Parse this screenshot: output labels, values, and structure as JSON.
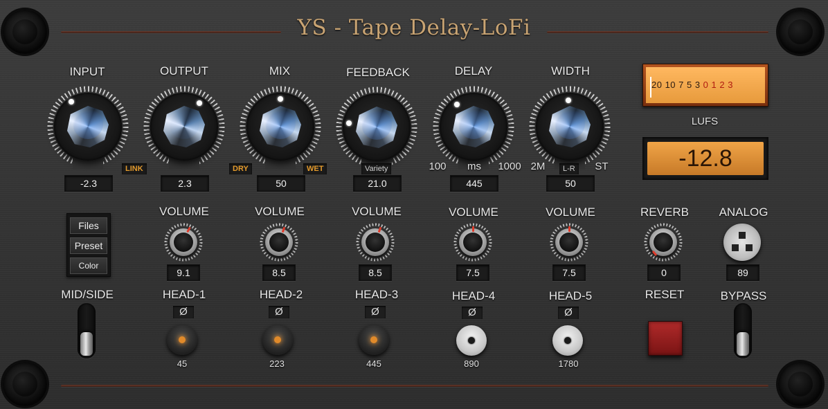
{
  "title": "YS - Tape Delay-LoFi",
  "main_knobs": [
    {
      "label": "INPUT",
      "value": "-2.3"
    },
    {
      "label": "OUTPUT",
      "value": "2.3"
    },
    {
      "label": "MIX",
      "value": "50"
    },
    {
      "label": "FEEDBACK",
      "value": "21.0"
    },
    {
      "label": "DELAY",
      "value": "445"
    },
    {
      "label": "WIDTH",
      "value": "50"
    }
  ],
  "knob_tags": {
    "link": "LINK",
    "dry": "DRY",
    "wet": "WET",
    "variety": "Variety",
    "delay_min": "100",
    "delay_unit": "ms",
    "delay_max": "1000",
    "width_min": "2M",
    "width_mid": "L-R",
    "width_max": "ST"
  },
  "meter": {
    "scale_black": "20  10  7  5  3  ",
    "scale_red": "0 1 2 3",
    "lufs_label": "LUFS",
    "lufs_value": "-12.8"
  },
  "menu": {
    "files": "Files",
    "preset": "Preset",
    "color": "Color"
  },
  "volumes": [
    {
      "label": "VOLUME",
      "value": "9.1"
    },
    {
      "label": "VOLUME",
      "value": "8.5"
    },
    {
      "label": "VOLUME",
      "value": "8.5"
    },
    {
      "label": "VOLUME",
      "value": "7.5"
    },
    {
      "label": "VOLUME",
      "value": "7.5"
    }
  ],
  "reverb": {
    "label": "REVERB",
    "value": "0"
  },
  "analog": {
    "label": "ANALOG",
    "value": "89"
  },
  "mid_side": {
    "label": "MID/SIDE"
  },
  "heads": [
    {
      "label": "HEAD-1",
      "phase": "Ø",
      "value": "45",
      "active": true
    },
    {
      "label": "HEAD-2",
      "phase": "Ø",
      "value": "223",
      "active": true
    },
    {
      "label": "HEAD-3",
      "phase": "Ø",
      "value": "445",
      "active": true
    },
    {
      "label": "HEAD-4",
      "phase": "Ø",
      "value": "890",
      "active": false
    },
    {
      "label": "HEAD-5",
      "phase": "Ø",
      "value": "1780",
      "active": false
    }
  ],
  "reset": {
    "label": "RESET"
  },
  "bypass": {
    "label": "BYPASS"
  },
  "colors": {
    "title": "#c9a473",
    "tag_orange": "#e39a2c",
    "lufs_amber": "#f0a447",
    "reset_red": "#b02a2a",
    "rule_copper": "#6a3a2c"
  }
}
